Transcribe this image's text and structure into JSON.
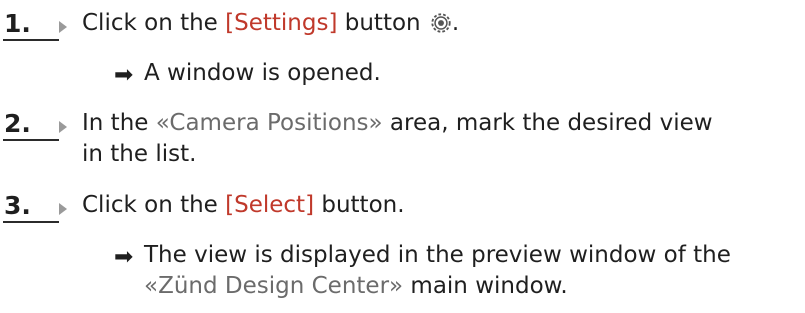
{
  "steps": [
    {
      "number": "1.",
      "text_before": "Click on the ",
      "keyword": "[Settings]",
      "text_after": " button ",
      "icon": "settings-gear-icon",
      "trail": ".",
      "result": "A window is opened."
    },
    {
      "number": "2.",
      "text_before": "In the ",
      "reference": "«Camera Positions»",
      "text_after_line1": " area, mark the desired view",
      "text_line2": "in the list."
    },
    {
      "number": "3.",
      "text_before": "Click on the ",
      "keyword": "[Select]",
      "text_after": " button.",
      "result_line1": "The view is displayed in the preview window of the",
      "result_reference": "«Zünd Design Center»",
      "result_line2_after": " main window."
    }
  ],
  "colors": {
    "keyword": "#c0392b",
    "reference": "#6b6b6b",
    "text": "#1f1f1f"
  },
  "result_arrow": "➡"
}
